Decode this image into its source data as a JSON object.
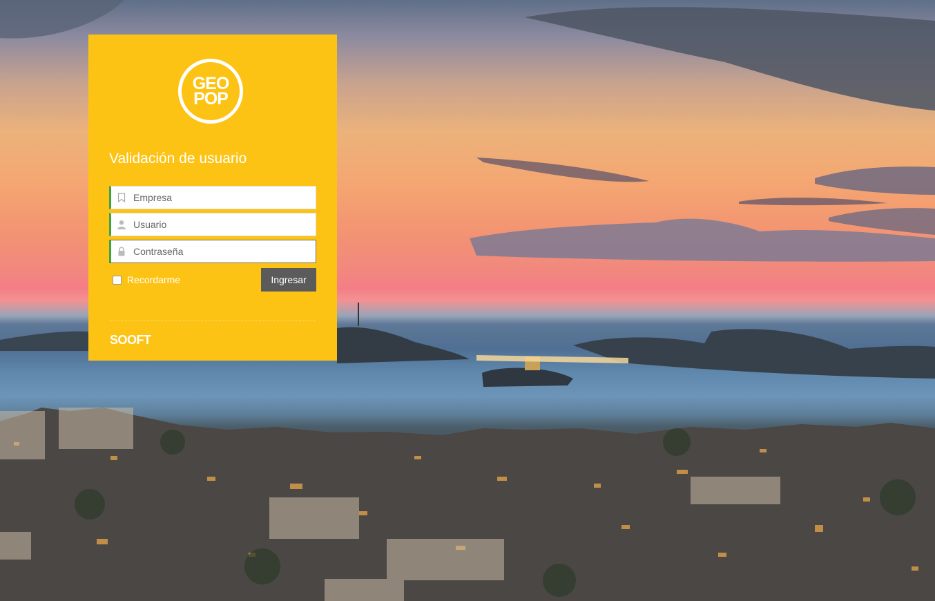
{
  "logo": {
    "line1": "GEO",
    "line2": "POP"
  },
  "form": {
    "title": "Validación de usuario",
    "company_placeholder": "Empresa",
    "company_value": "",
    "user_placeholder": "Usuario",
    "user_value": "",
    "password_placeholder": "Contraseña",
    "password_value": "",
    "remember_label": "Recordarme",
    "remember_checked": false,
    "submit_label": "Ingresar"
  },
  "footer": {
    "brand": "SOOFT"
  },
  "icons": {
    "company": "bookmark-icon",
    "user": "user-icon",
    "password": "lock-icon"
  },
  "colors": {
    "card": "#fdc314",
    "button": "#5b5b5b",
    "field_accent": "#3fa33f"
  }
}
